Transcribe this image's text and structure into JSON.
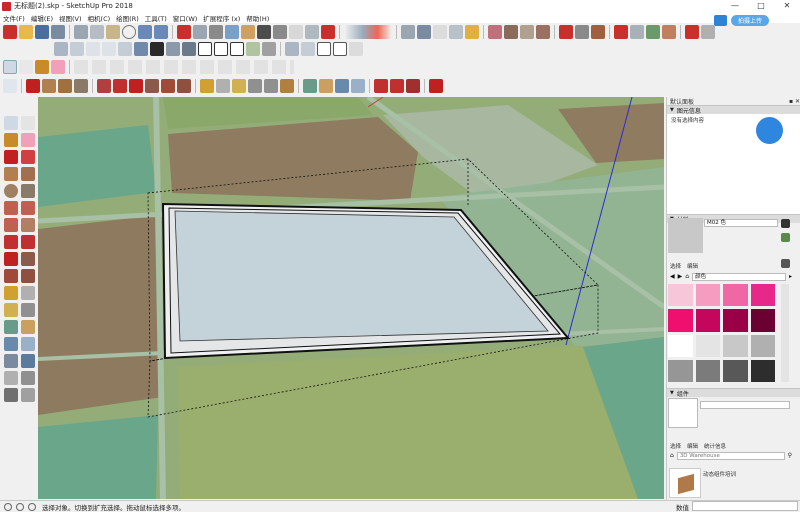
{
  "window": {
    "title": "无标题(2).skp - SketchUp Pro 2018",
    "min": "—",
    "max": "□",
    "close": "✕"
  },
  "menu": [
    "文件(F)",
    "编辑(E)",
    "视图(V)",
    "相机(C)",
    "绘图(R)",
    "工具(T)",
    "窗口(W)",
    "扩展程序 (x)",
    "帮助(H)"
  ],
  "cloud": {
    "label": "拍摄上传"
  },
  "tray": {
    "title": "默认面板",
    "entity_info": {
      "header": "图元信息",
      "text": "没有选择内容"
    },
    "materials": {
      "header": "材料",
      "name": "M02 色",
      "tabs": [
        "选择",
        "编辑"
      ],
      "dropdown": "颜色",
      "swatches": [
        "#f7c6d8",
        "#f59cc0",
        "#f067a6",
        "#e8278a",
        "#ee0f6e",
        "#c4075c",
        "#9b0047",
        "#6b0032",
        "#ffffff",
        "#e4e4e4",
        "#c8c8c8",
        "#b0b0b0",
        "#969696",
        "#7b7b7b",
        "#585858",
        "#2d2d2d"
      ]
    },
    "components": {
      "header": "组件",
      "tabs": [
        "选择",
        "编辑",
        "统计信息"
      ],
      "search_placeholder": "3D Warehouse",
      "item_label": "动态组件培训"
    }
  },
  "status": {
    "text": "选择对象。切换到扩充选择。拖动鼠标选择多项。",
    "measure_label": "数值"
  },
  "colors": {
    "accent": "#2c84d6",
    "selection": "#000000",
    "axis_blue": "#2b2bd6"
  }
}
